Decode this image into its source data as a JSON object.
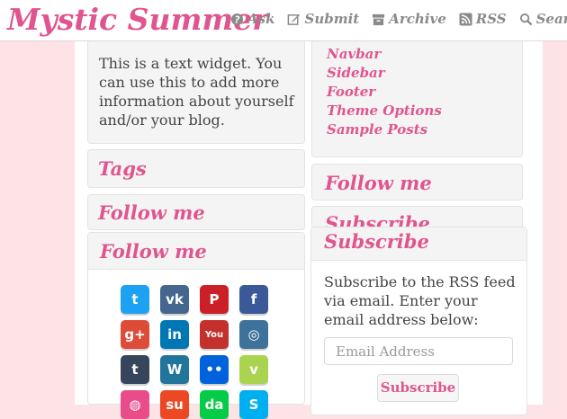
{
  "header": {
    "logo": "Mystic Summer",
    "nav": [
      {
        "label": "Ask",
        "icon": "question-circle-icon"
      },
      {
        "label": "Submit",
        "icon": "edit-icon"
      },
      {
        "label": "Archive",
        "icon": "archive-icon"
      },
      {
        "label": "RSS",
        "icon": "rss-icon"
      },
      {
        "label": "Search",
        "icon": "search-icon"
      }
    ]
  },
  "left": {
    "text_widget": "This is a text widget. You can use this to add more information about yourself and/or your blog.",
    "tags_title": "Tags",
    "follow_title_1": "Follow me",
    "follow_title_2": "Follow me",
    "social": [
      {
        "name": "twitter",
        "glyph": "t",
        "color": "#1da1f2"
      },
      {
        "name": "vk",
        "glyph": "vk",
        "color": "#45668e"
      },
      {
        "name": "pinterest",
        "glyph": "P",
        "color": "#cb2027"
      },
      {
        "name": "facebook",
        "glyph": "f",
        "color": "#3b5998"
      },
      {
        "name": "google-plus",
        "glyph": "g+",
        "color": "#dd4b39"
      },
      {
        "name": "linkedin",
        "glyph": "in",
        "color": "#0077b5"
      },
      {
        "name": "youtube",
        "glyph": "You",
        "color": "#c4302b"
      },
      {
        "name": "instagram",
        "glyph": "◎",
        "color": "#3f729b"
      },
      {
        "name": "tumblr",
        "glyph": "t",
        "color": "#35465c"
      },
      {
        "name": "wordpress",
        "glyph": "W",
        "color": "#21759b"
      },
      {
        "name": "flickr",
        "glyph": "••",
        "color": "#0063dc"
      },
      {
        "name": "vimeo",
        "glyph": "v",
        "color": "#aad450"
      },
      {
        "name": "dribbble",
        "glyph": "◍",
        "color": "#ea4c89"
      },
      {
        "name": "stumbleupon",
        "glyph": "su",
        "color": "#eb4823"
      },
      {
        "name": "deviantart",
        "glyph": "da",
        "color": "#05cc47"
      },
      {
        "name": "skype",
        "glyph": "S",
        "color": "#00aff0"
      }
    ]
  },
  "right": {
    "links": [
      "Navbar",
      "Sidebar",
      "Footer",
      "Theme Options",
      "Sample Posts"
    ],
    "follow_title": "Follow me",
    "subscribe_title_back": "Subscribe",
    "subscribe_title": "Subscribe",
    "subscribe_text": "Subscribe to the RSS feed via email. Enter your email address below:",
    "email_placeholder": "Email Address",
    "subscribe_button": "Subscribe"
  }
}
